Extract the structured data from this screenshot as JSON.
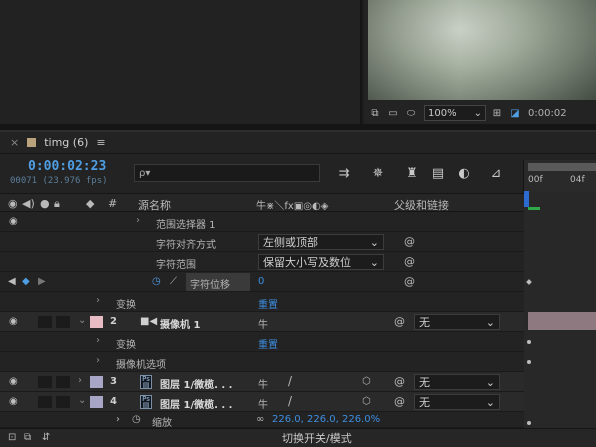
{
  "viewer": {
    "zoom": "100%",
    "time": "0:00:02"
  },
  "timeline": {
    "tab_title": "timg (6)",
    "menu_glyph": "≡",
    "close_glyph": "×",
    "timecode": "0:00:02:23",
    "frame_info": "00071 (23.976 fps)",
    "search_placeholder": "ρ▾",
    "ruler_ticks": [
      "00f",
      "04f"
    ],
    "header": {
      "source_name": "源名称",
      "parent_link": "父级和链接",
      "hash": "#"
    },
    "footer_label": "切换开关/模式"
  },
  "rows": {
    "range_selector": "范围选择器 1",
    "char_align_label": "字符对齐方式",
    "char_align_value": "左侧或顶部",
    "char_range_label": "字符范围",
    "char_range_value": "保留大小写及数位",
    "char_offset_label": "字符位移",
    "char_offset_value": "0",
    "transform_1": "变换",
    "reset_1": "重置",
    "layer2_num": "2",
    "layer2_name": "摄像机 1",
    "layer2_parent": "无",
    "transform_2": "变换",
    "reset_2": "重置",
    "camera_options": "摄像机选项",
    "layer3_num": "3",
    "layer3_name": "图层 1/微榄. . .",
    "layer3_parent": "无",
    "layer4_num": "4",
    "layer4_name": "图层 1/微榄. . .",
    "layer4_parent": "无",
    "scale_label": "缩放",
    "scale_value": "226.0, 226.0, 226.0%"
  },
  "colors": {
    "timecode": "#4f9ee3",
    "link_blue": "#3d8ee0",
    "layer2_label": "#e8bcc5",
    "layer34_label": "#a8a6c6",
    "layer_bar": "#8f7980"
  }
}
